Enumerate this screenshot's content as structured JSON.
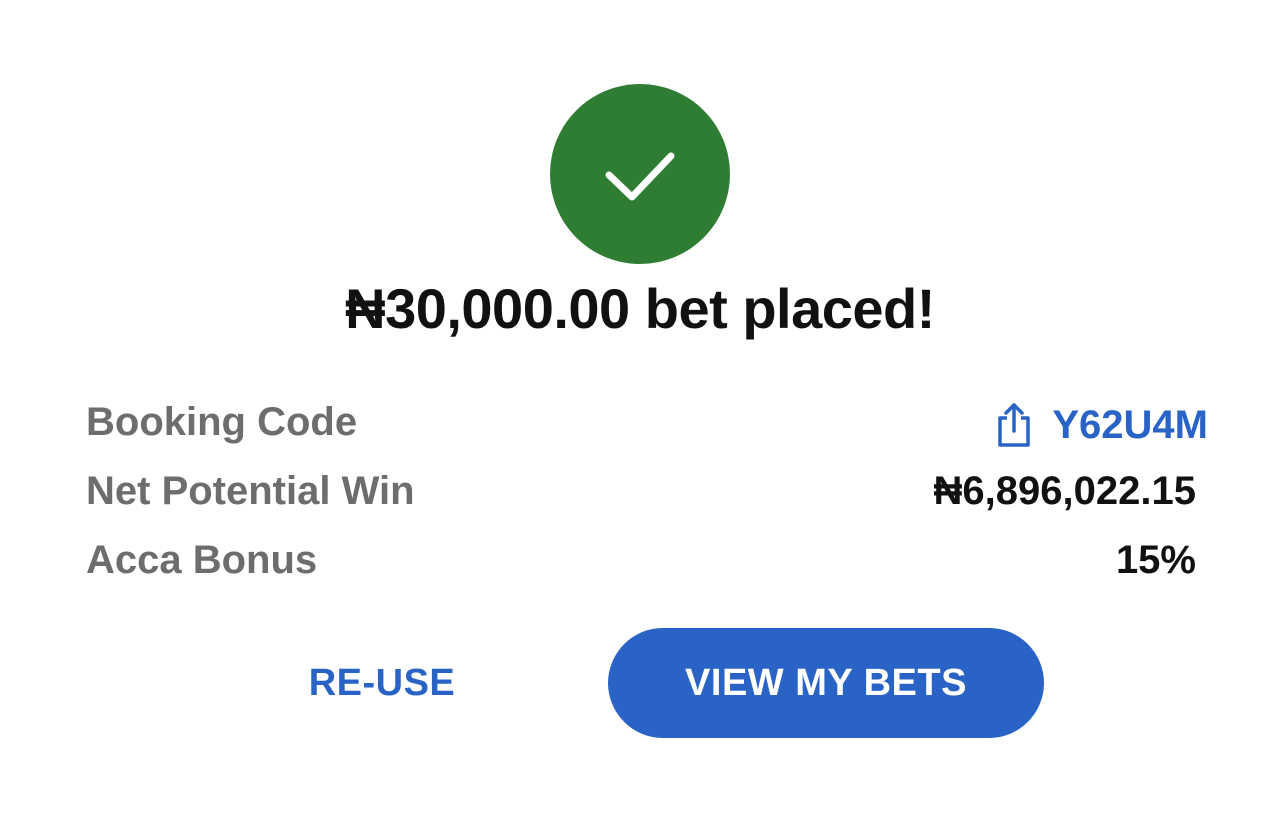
{
  "status": {
    "icon": "checkmark-icon",
    "color": "#2e7d32",
    "headline": "₦30,000.00 bet placed!"
  },
  "details": {
    "booking_code": {
      "label": "Booking Code",
      "icon": "share-icon",
      "value": "Y62U4M",
      "color": "#2a63c6"
    },
    "net_potential_win": {
      "label": "Net Potential Win",
      "value": "₦6,896,022.15"
    },
    "acca_bonus": {
      "label": "Acca Bonus",
      "value": "15%"
    }
  },
  "actions": {
    "reuse_label": "RE-USE",
    "view_bets_label": "VIEW MY BETS",
    "accent_color": "#2a63c6"
  }
}
